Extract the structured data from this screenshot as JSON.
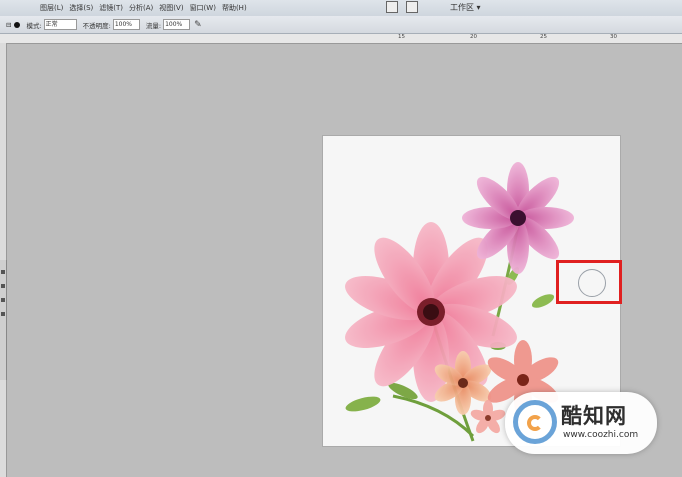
{
  "menu": {
    "items": [
      "图层(L)",
      "选择(S)",
      "滤镜(T)",
      "分析(A)",
      "视图(V)",
      "窗口(W)",
      "帮助(H)"
    ],
    "workspace": "工作区 ▾"
  },
  "options": {
    "mode_label": "模式:",
    "mode_value": "正常",
    "opacity_label": "不透明度:",
    "opacity_value": "100%",
    "flow_label": "流量:",
    "flow_value": "100%"
  },
  "ruler": {
    "top_numbers": [
      "15",
      "20",
      "25",
      "30"
    ]
  },
  "watermark": {
    "title": "酷知网",
    "url": "www.coozhi.com"
  },
  "colors": {
    "highlight": "#e02020",
    "workspace_bg": "#bdbdbd"
  }
}
